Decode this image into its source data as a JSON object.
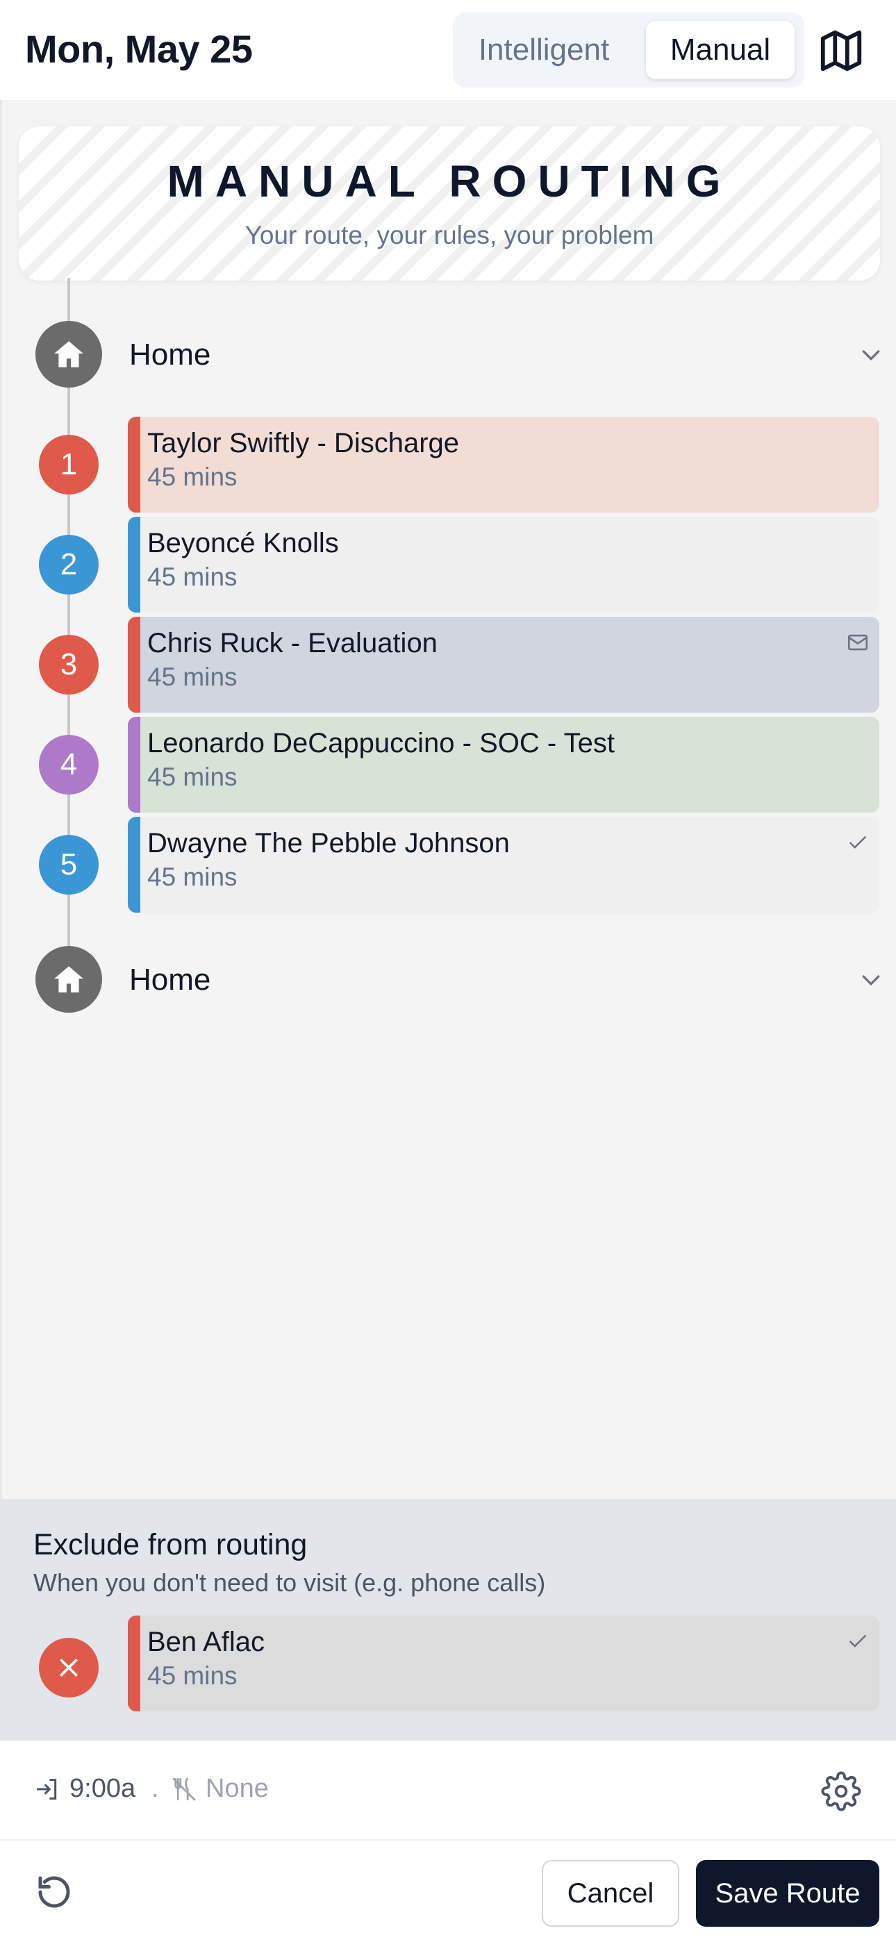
{
  "header": {
    "date": "Mon, May 25",
    "mode_options": {
      "intelligent": "Intelligent",
      "manual": "Manual"
    },
    "selected_mode": "Manual",
    "map_icon": "map-icon"
  },
  "banner": {
    "title": "MANUAL ROUTING",
    "subtitle": "Your route, your rules, your problem"
  },
  "route": {
    "start": {
      "label": "Home",
      "icon": "home-icon"
    },
    "stops": [
      {
        "number": "1",
        "name": "Taylor Swiftly - Discharge",
        "duration": "45 mins",
        "accent": "#e05a4b",
        "bg": "#f2ddd5",
        "icon": ""
      },
      {
        "number": "2",
        "name": "Beyoncé Knolls",
        "duration": "45 mins",
        "accent": "#3b96d6",
        "bg": "#efefef",
        "icon": ""
      },
      {
        "number": "3",
        "name": "Chris Ruck - Evaluation",
        "duration": "45 mins",
        "accent": "#e05a4b",
        "bg": "#d0d5e0",
        "icon": "mail-icon"
      },
      {
        "number": "4",
        "name": "Leonardo DeCappuccino - SOC - Test",
        "duration": "45 mins",
        "accent": "#ad7ac9",
        "bg": "#d8e3d8",
        "icon": ""
      },
      {
        "number": "5",
        "name": "Dwayne The Pebble Johnson",
        "duration": "45 mins",
        "accent": "#3b96d6",
        "bg": "#efefef",
        "icon": "check-icon"
      }
    ],
    "end": {
      "label": "Home",
      "icon": "home-icon"
    }
  },
  "exclude": {
    "title": "Exclude from routing",
    "subtitle": "When you don't need to visit (e.g. phone calls)",
    "items": [
      {
        "name": "Ben Aflac",
        "duration": "45 mins",
        "accent": "#e05a4b",
        "bg": "#dcdcdc",
        "icon": "check-icon"
      }
    ]
  },
  "info": {
    "start_time": "9:00a",
    "separator": ".",
    "lunch": "None"
  },
  "actions": {
    "cancel": "Cancel",
    "save": "Save Route"
  }
}
